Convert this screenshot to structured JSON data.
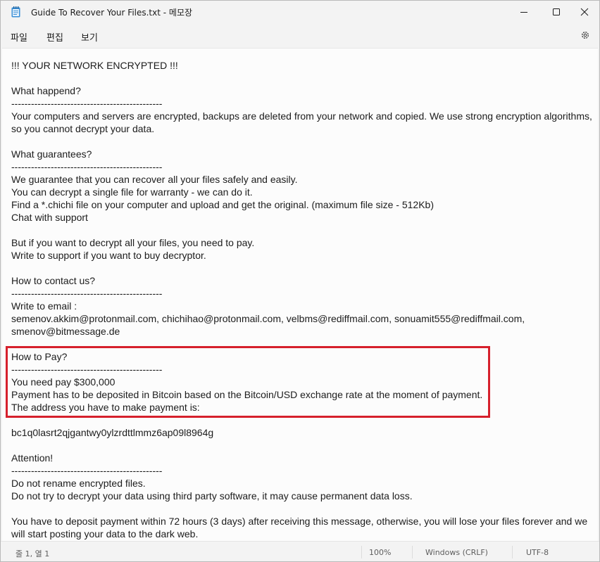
{
  "window": {
    "title": "Guide To Recover Your Files.txt - 메모장",
    "app_icon": "notepad-icon",
    "controls": {
      "minimize_icon": "minimize-icon",
      "maximize_icon": "maximize-icon",
      "close_icon": "close-icon"
    }
  },
  "menubar": {
    "file": "파일",
    "edit": "편집",
    "view": "보기",
    "settings_icon": "gear-icon"
  },
  "editor": {
    "lines": [
      "!!! YOUR NETWORK ENCRYPTED !!!",
      "",
      "What happend?",
      "----------------------------------------------",
      "Your computers and servers are encrypted, backups are deleted from your network and copied. We use strong encryption algorithms,",
      "so you cannot decrypt your data.",
      "",
      "What guarantees?",
      "----------------------------------------------",
      "We guarantee that you can recover all your files safely and easily.",
      "You can decrypt a single file for warranty - we can do it.",
      "Find a *.chichi file on your computer and upload and get the original. (maximum file size - 512Kb)",
      "Chat with support",
      "",
      "But if you want to decrypt all your files, you need to pay.",
      "Write to support if you want to buy decryptor.",
      "",
      "How to contact us?",
      "----------------------------------------------",
      "Write to email :",
      "semenov.akkim@protonmail.com, chichihao@protonmail.com, velbms@rediffmail.com, sonuamit555@rediffmail.com,",
      "smenov@bitmessage.de",
      "",
      "How to Pay?",
      "----------------------------------------------",
      "You need pay $300,000",
      "Payment has to be deposited in Bitcoin based on the Bitcoin/USD exchange rate at the moment of payment.",
      "The address you have to make payment is:",
      "",
      "bc1q0lasrt2qjgantwy0ylzrdttlmmz6ap09l8964g",
      "",
      "Attention!",
      "----------------------------------------------",
      "Do not rename encrypted files.",
      "Do not try to decrypt your data using third party software, it may cause permanent data loss.",
      "",
      "You have to deposit payment within 72 hours (3 days) after receiving this message, otherwise, you will lose your files forever and we",
      "will start posting your data to the dark web."
    ],
    "highlight_color": "#d6202c"
  },
  "statusbar": {
    "position": "줄 1, 열 1",
    "zoom": "100%",
    "line_ending": "Windows (CRLF)",
    "encoding": "UTF-8"
  }
}
